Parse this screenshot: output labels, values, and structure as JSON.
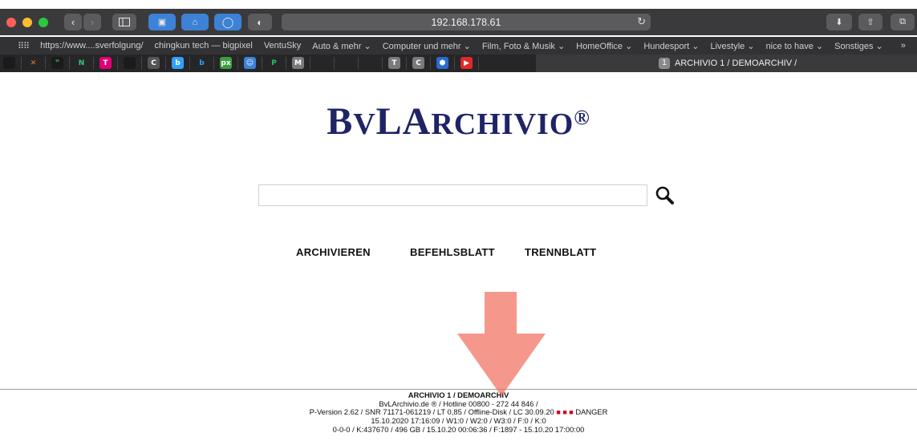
{
  "browser": {
    "address": "192.168.178.61",
    "bookmarks": [
      "https://www....sverfolgung/",
      "chingkun tech — bigpixel",
      "VentuSky",
      "Auto & mehr ⌄",
      "Computer und mehr ⌄",
      "Film, Foto & Musik ⌄",
      "HomeOffice ⌄",
      "Hundesport ⌄",
      "Livestyle ⌄",
      "nice to have ⌄",
      "Sonstiges ⌄"
    ],
    "active_tab_number": "1",
    "active_tab_title": "ARCHIVIO 1 / DEMOARCHIV /",
    "colors": {
      "titlebar": "#3a3a3c",
      "close": "#fe5f57",
      "minimize": "#febc2e",
      "maximize": "#28c840"
    },
    "tab_icons": [
      {
        "name": "bookmark-square-icon",
        "glyph": "",
        "bg": "#1b1b1b"
      },
      {
        "name": "x-logo-icon",
        "glyph": "✕",
        "bg": "transparent",
        "color": "#f07b1f"
      },
      {
        "name": "chat-bubble-icon",
        "glyph": "❞",
        "bg": "#1b1b1b",
        "color": "#2fb14f"
      },
      {
        "name": "n-logo-icon",
        "glyph": "N",
        "bg": "transparent",
        "color": "#39c87a"
      },
      {
        "name": "telekom-icon",
        "glyph": "T",
        "bg": "#e20074"
      },
      {
        "name": "blank-tab-icon",
        "glyph": "",
        "bg": "#1b1b1b"
      },
      {
        "name": "cups-icon",
        "glyph": "C",
        "bg": "#555"
      },
      {
        "name": "b-logo-icon",
        "glyph": "b",
        "bg": "#2ea1ff"
      },
      {
        "name": "b-small-icon",
        "glyph": "b",
        "bg": "transparent",
        "color": "#2ea1ff"
      },
      {
        "name": "px-icon",
        "glyph": "px",
        "bg": "#3d9e3d"
      },
      {
        "name": "robot-icon",
        "glyph": "☺",
        "bg": "#3b82d8"
      },
      {
        "name": "p-logo-icon",
        "glyph": "P",
        "bg": "transparent",
        "color": "#21c26b"
      },
      {
        "name": "m-logo-icon",
        "glyph": "M",
        "bg": "#7a7a7a"
      },
      {
        "name": "apple-icon",
        "glyph": "",
        "bg": "transparent",
        "color": "#bbb"
      },
      {
        "name": "apple-icon",
        "glyph": "",
        "bg": "transparent",
        "color": "#bbb"
      },
      {
        "name": "apple-icon",
        "glyph": "",
        "bg": "transparent",
        "color": "#bbb"
      },
      {
        "name": "t-logo-icon",
        "glyph": "T",
        "bg": "#7a7a7a"
      },
      {
        "name": "c-logo-icon",
        "glyph": "C",
        "bg": "#7a7a7a"
      },
      {
        "name": "hex-icon",
        "glyph": "⬢",
        "bg": "#2a6bd1"
      },
      {
        "name": "youtube-icon",
        "glyph": "▶",
        "bg": "#e02a2a"
      }
    ]
  },
  "page": {
    "logo": {
      "part1_big": "B",
      "part1_small": "V",
      "part2_big": "LA",
      "part2_small": "RCHIVIO",
      "mark": "®"
    },
    "nav": [
      "ARCHIVIEREN",
      "BEFEHLSBLATT",
      "TRENNBLATT"
    ],
    "footer": {
      "title": "ARCHIVIO 1 / DEMOARCHIV",
      "line1": "BvLArchivio.de ® / Hotline 00800 - 272 44 846 /",
      "line2_pre": "P-Version 2.62 / SNR 71171-061219 / LT 0,85 / Offline-Disk / LC 30.09.20",
      "line2_dots": "■ ■ ■",
      "line2_post": "DANGER",
      "line3": "15.10.2020 17:16:09 / W1:0 / W2:0 / W3:0 / F:0 / K:0",
      "line4": "0-0-0 / K:437670 / 496 GB / 15.10.20 00:06:36 / F:1897 - 15.10.20 17:00:00"
    },
    "colors": {
      "logo": "#1e2466",
      "arrow": "#f26b5b",
      "danger": "#d0021b"
    }
  }
}
